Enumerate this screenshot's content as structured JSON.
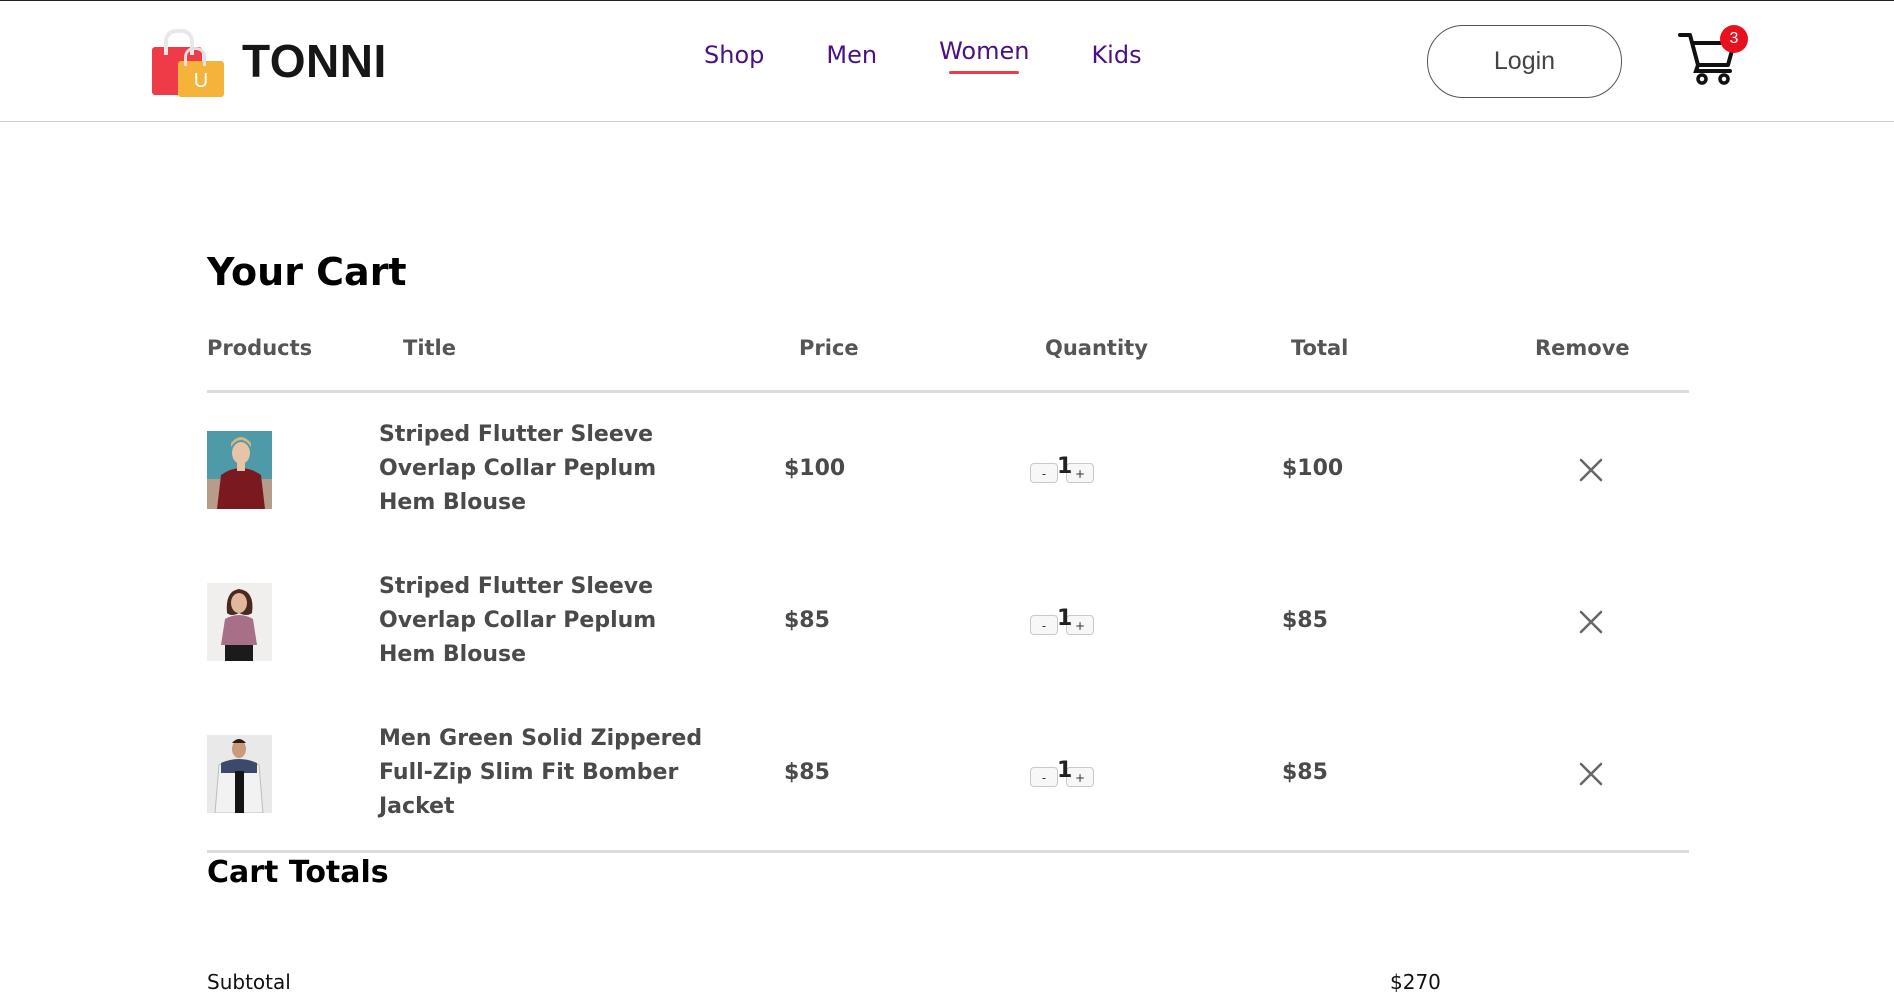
{
  "brand": {
    "name": "TONNI",
    "bag_letter": "U"
  },
  "nav": {
    "items": [
      {
        "label": "Shop"
      },
      {
        "label": "Men"
      },
      {
        "label": "Women",
        "active": true
      },
      {
        "label": "Kids"
      }
    ],
    "login_label": "Login",
    "cart_count": "3"
  },
  "cart": {
    "title": "Your Cart",
    "columns": {
      "products": "Products",
      "title": "Title",
      "price": "Price",
      "quantity": "Quantity",
      "total": "Total",
      "remove": "Remove"
    },
    "items": [
      {
        "title": "Striped Flutter Sleeve Overlap Collar Peplum Hem Blouse",
        "price": "$100",
        "quantity": "1",
        "total": "$100",
        "image": "woman-in-red-shawl-photo"
      },
      {
        "title": "Striped Flutter Sleeve Overlap Collar Peplum Hem Blouse",
        "price": "$85",
        "quantity": "1",
        "total": "$85",
        "image": "woman-in-mauve-blouse-photo"
      },
      {
        "title": "Men Green Solid Zippered Full-Zip Slim Fit Bomber Jacket",
        "price": "$85",
        "quantity": "1",
        "total": "$85",
        "image": "man-in-bomber-jacket-photo"
      }
    ],
    "minus_label": "-",
    "plus_label": "+"
  },
  "totals": {
    "title": "Cart Totals",
    "subtotal_label": "Subtotal",
    "subtotal_value": "$270"
  },
  "colors": {
    "nav_text": "#4b1180",
    "accent_red": "#ef3b48",
    "badge_red": "#e8121f"
  }
}
